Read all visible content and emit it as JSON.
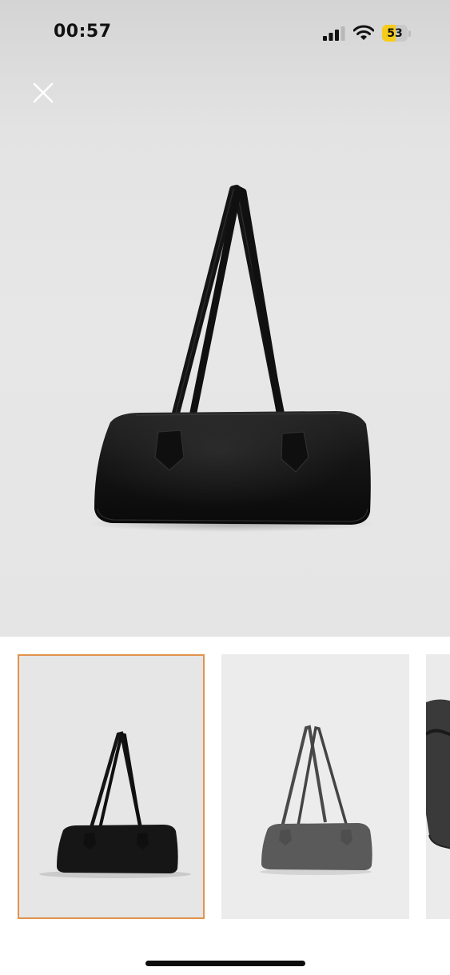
{
  "status_bar": {
    "time": "00:57",
    "battery_level": "53",
    "battery_fraction": 0.53,
    "battery_color": "#f6cc1c",
    "signal_icon": "cellular-signal-icon",
    "wifi_icon": "wifi-icon"
  },
  "viewer": {
    "close_icon": "close-icon",
    "photo_subject": "black-shoulder-bag"
  },
  "thumbnails": {
    "selected_index": 0,
    "selected_border_color": "#e0934c",
    "count_visible": 3
  }
}
